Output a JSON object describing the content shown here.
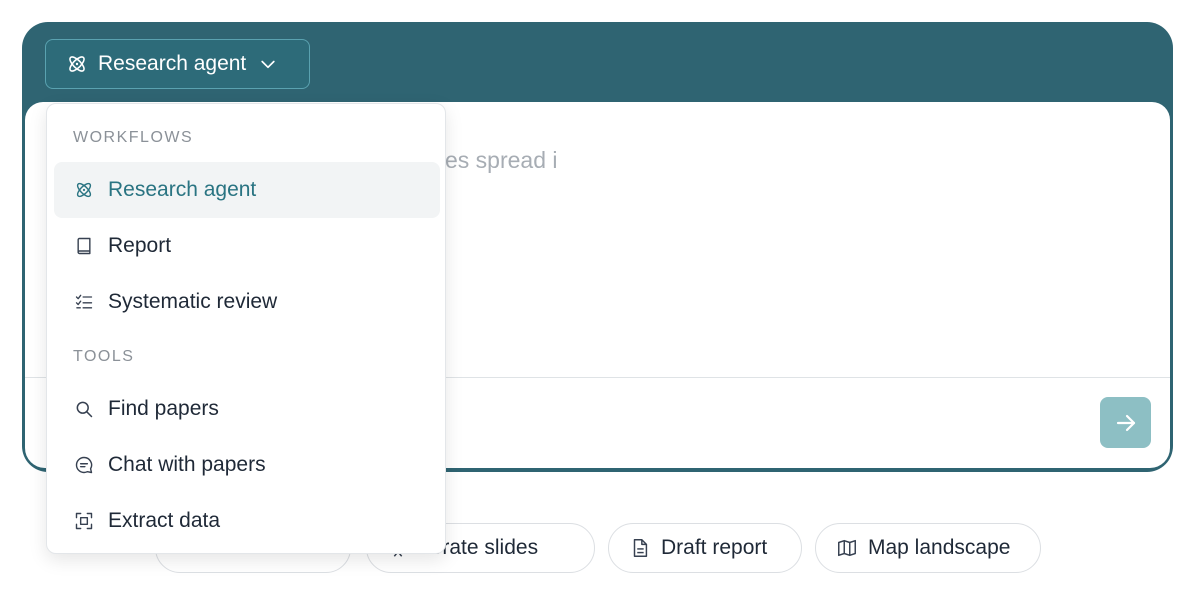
{
  "composer": {
    "agent_button_label": "Research agent",
    "prompt_text": "es spread i"
  },
  "dropdown": {
    "sections": [
      {
        "label": "WORKFLOWS",
        "items": [
          {
            "label": "Research agent",
            "icon": "atom-icon",
            "active": true
          },
          {
            "label": "Report",
            "icon": "book-icon",
            "active": false
          },
          {
            "label": "Systematic review",
            "icon": "checklist-icon",
            "active": false
          }
        ]
      },
      {
        "label": "TOOLS",
        "items": [
          {
            "label": "Find papers",
            "icon": "search-icon",
            "active": false
          },
          {
            "label": "Chat with papers",
            "icon": "chat-bubble-icon",
            "active": false
          },
          {
            "label": "Extract data",
            "icon": "scan-frame-icon",
            "active": false
          }
        ]
      }
    ]
  },
  "suggestions": [
    {
      "label": "",
      "icon": "",
      "partially_hidden": true
    },
    {
      "label": "nerate slides",
      "icon": "slides-icon",
      "partially_hidden": true
    },
    {
      "label": "Draft report",
      "icon": "document-icon",
      "partially_hidden": false
    },
    {
      "label": "Map landscape",
      "icon": "map-icon",
      "partially_hidden": false
    }
  ],
  "colors": {
    "panel_bg": "#2f6472",
    "accent_text": "#2a7482",
    "send_button": "#8dbfc4",
    "muted_text": "#8b9198"
  }
}
